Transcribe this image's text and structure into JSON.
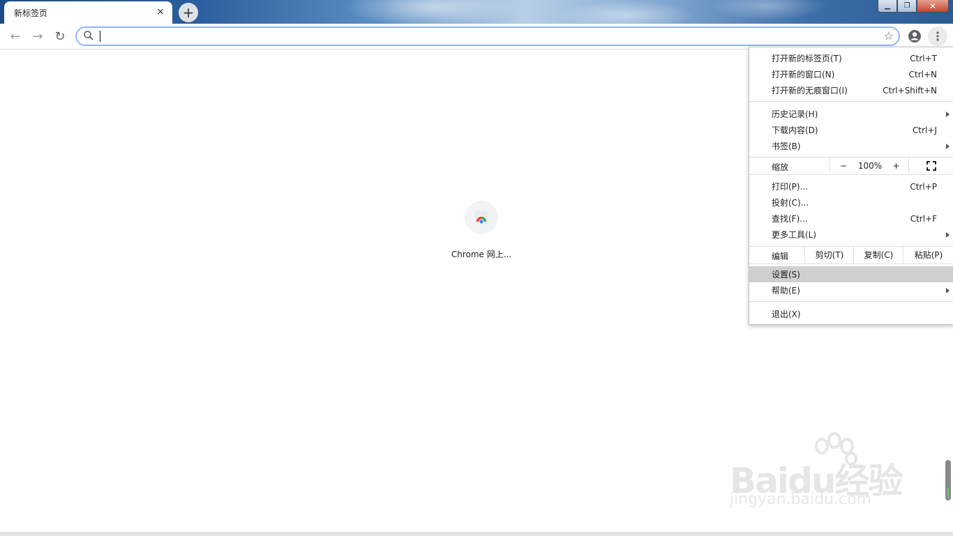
{
  "tab": {
    "title": "新标签页",
    "close": "×"
  },
  "newtab": {
    "label": "+"
  },
  "window_controls": {
    "minimize": "▁",
    "maximize": "❐",
    "close": "✕"
  },
  "toolbar": {
    "back": "←",
    "forward": "→",
    "reload": "↻",
    "star": "☆"
  },
  "shortcut": {
    "label": "Chrome 网上..."
  },
  "menu": {
    "new_tab": {
      "label": "打开新的标签页(T)",
      "accel": "Ctrl+T"
    },
    "new_window": {
      "label": "打开新的窗口(N)",
      "accel": "Ctrl+N"
    },
    "incognito": {
      "label": "打开新的无痕窗口(I)",
      "accel": "Ctrl+Shift+N"
    },
    "history": {
      "label": "历史记录(H)"
    },
    "downloads": {
      "label": "下载内容(D)",
      "accel": "Ctrl+J"
    },
    "bookmarks": {
      "label": "书签(B)"
    },
    "zoom": {
      "label": "缩放",
      "minus": "−",
      "value": "100%",
      "plus": "+"
    },
    "print": {
      "label": "打印(P)...",
      "accel": "Ctrl+P"
    },
    "cast": {
      "label": "投射(C)..."
    },
    "find": {
      "label": "查找(F)...",
      "accel": "Ctrl+F"
    },
    "more_tools": {
      "label": "更多工具(L)"
    },
    "edit": {
      "label": "编辑",
      "cut": "剪切(T)",
      "copy": "复制(C)",
      "paste": "粘贴(P)"
    },
    "settings": {
      "label": "设置(S)"
    },
    "help": {
      "label": "帮助(E)"
    },
    "exit": {
      "label": "退出(X)"
    }
  },
  "watermark": {
    "brand": "Baidu经验",
    "url": "jingyan.baidu.com"
  },
  "colors": {
    "accent": "#8ab4f8",
    "highlight": "#cfcfcf"
  }
}
